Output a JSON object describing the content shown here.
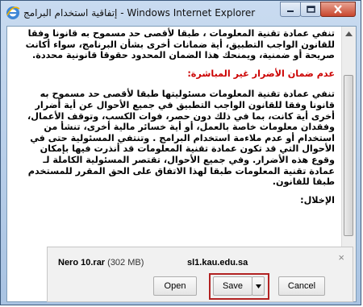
{
  "window": {
    "title": "إتفاقية استخدام البرامج - Windows Internet Explorer",
    "controls": {
      "minimize": "minimize",
      "maximize": "maximize",
      "close": "close"
    }
  },
  "content": {
    "para1": "تنفي عمادة تقنية المعلومات ، طبقا لأقصى حد مسموح به قانونا وفقا للقانون الواجب التطبيق، أية ضمانات أخرى بشأن البرنامج، سواء أكانت صريحة أو ضمنية، ويمنحك هذا الضمان المحدود حقوقا قانونية محددة.",
    "heading": "عدم ضمان الأضرار غير المباشرة:",
    "para2": "تنفي عمادة تقنية المعلومات مسئوليتها طبقا لأقصى حد مسموح به قانونا وفقا للقانون الواجب التطبيق في جميع الأحوال عن أية أضرار أخرى أية كانت، بما في ذلك دون حصر، فوات الكسب، وتوقف الأعمال، وفقدان معلومات خاصة بالعمل، أو أية خسائر مالية أخرى، تنشأ من استخدام أو عدم ملاءمة استخدام البرامج . وتنتفي المسئولية حتى في الأحوال التي قد تكون عمادة تقنية المعلومات قد أنذرت فيها بإمكان وقوع هذه الأضرار. وفي جميع الأحوال، تقتصر المسئولية الكاملة لـ عمادة تقنية المعلومات طبقا لهذا الاتفاق على الحق المقرر للمستخدم طبقا للقانون.",
    "para3": "الإخلال:"
  },
  "download_bar": {
    "filename": "Nero 10.rar",
    "size": "(302 MB)",
    "site": "sl1.kau.edu.sa",
    "open_label": "Open",
    "save_label": "Save",
    "cancel_label": "Cancel",
    "close_symbol": "×"
  }
}
